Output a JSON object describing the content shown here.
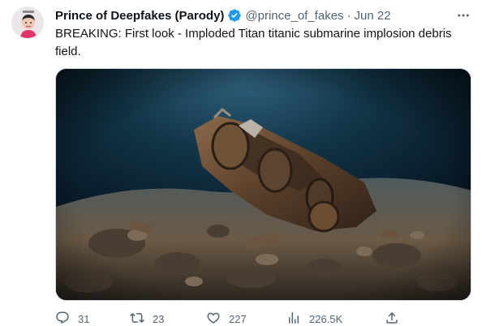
{
  "tweet": {
    "author": {
      "display_name": "Prince of Deepfakes (Parody)",
      "handle": "@prince_of_fakes",
      "verified": true,
      "avatar_icon": "cartoon-avatar"
    },
    "date": "Jun 22",
    "separator": "·",
    "text": "BREAKING: First look - Imploded Titan titanic submarine implosion debris field.",
    "media": {
      "type": "image",
      "depicts": "underwater-wreckage"
    },
    "actions": {
      "replies": "31",
      "retweets": "23",
      "likes": "227",
      "views": "226.5K"
    }
  },
  "colors": {
    "text_primary": "#0f1419",
    "text_secondary": "#536471",
    "verified_blue": "#1d9bf0",
    "border": "#cfd9de"
  }
}
